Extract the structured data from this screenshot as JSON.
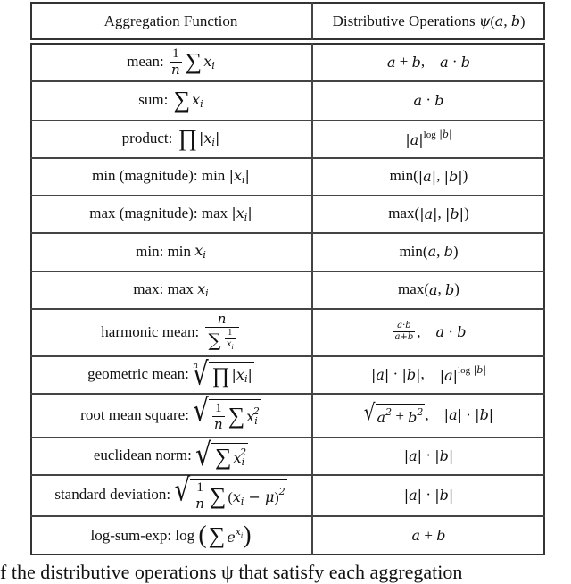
{
  "table": {
    "headers": [
      "Aggregation Function",
      "Distributive Operations ψ(a, b)"
    ],
    "rows": [
      {
        "name": "mean",
        "label": "mean:",
        "formula": "(1/n) Σ x_i",
        "ops": "a + b,   a · b"
      },
      {
        "name": "sum",
        "label": "sum:",
        "formula": "Σ x_i",
        "ops": "a · b"
      },
      {
        "name": "product",
        "label": "product:",
        "formula": "Π |x_i|",
        "ops": "|a|^(log |b|)"
      },
      {
        "name": "min-magnitude",
        "label": "min (magnitude):",
        "formula": "min |x_i|",
        "ops": "min(|a|, |b|)"
      },
      {
        "name": "max-magnitude",
        "label": "max (magnitude):",
        "formula": "max |x_i|",
        "ops": "max(|a|, |b|)"
      },
      {
        "name": "min",
        "label": "min:",
        "formula": "min x_i",
        "ops": "min(a, b)"
      },
      {
        "name": "max",
        "label": "max:",
        "formula": "max x_i",
        "ops": "max(a, b)"
      },
      {
        "name": "harmonic-mean",
        "label": "harmonic mean:",
        "formula": "n / Σ (1/x_i)",
        "ops": "(a·b)/(a+b),   a · b"
      },
      {
        "name": "geometric-mean",
        "label": "geometric mean:",
        "formula": "n-th root of Π |x_i|",
        "ops": "|a| · |b|,   |a|^(log |b|)"
      },
      {
        "name": "root-mean-square",
        "label": "root mean square:",
        "formula": "sqrt((1/n) Σ x_i^2)",
        "ops": "sqrt(a^2 + b^2),   |a| · |b|"
      },
      {
        "name": "euclidean-norm",
        "label": "euclidean norm:",
        "formula": "sqrt(Σ x_i^2)",
        "ops": "|a| · |b|"
      },
      {
        "name": "standard-deviation",
        "label": "standard deviation:",
        "formula": "sqrt((1/n) Σ (x_i − μ)^2)",
        "ops": "|a| · |b|"
      },
      {
        "name": "log-sum-exp",
        "label": "log-sum-exp:",
        "formula": "log(Σ e^(x_i))",
        "ops": "a + b"
      }
    ]
  },
  "caption": "f the distributive operations ψ that satisfy each aggregation"
}
